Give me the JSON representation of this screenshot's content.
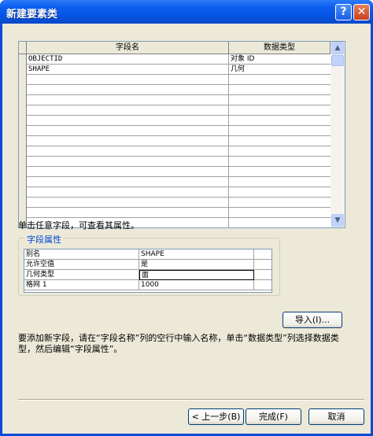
{
  "window": {
    "title": "新建要素类"
  },
  "titlebar": {
    "help_glyph": "?",
    "close_glyph": "✕"
  },
  "grid": {
    "col_field_name": "字段名",
    "col_data_type": "数据类型",
    "rows": [
      {
        "name": "OBJECTID",
        "type": "对象 ID"
      },
      {
        "name": "SHAPE",
        "type": "几何"
      }
    ]
  },
  "hint": "单击任意字段，可查看其属性。",
  "field_props": {
    "title": "字段属性",
    "rows": [
      {
        "key": "别名",
        "value": "SHAPE"
      },
      {
        "key": "允许空值",
        "value": "是"
      },
      {
        "key": "几何类型",
        "value": "面"
      },
      {
        "key": "格网 1",
        "value": "1000"
      }
    ]
  },
  "buttons": {
    "import": "导入(I)...",
    "back": "< 上一步(B)",
    "finish": "完成(F)",
    "cancel": "取消"
  },
  "description": "要添加新字段，请在“字段名称”列的空行中输入名称，单击“数据类型”列选择数据类型，然后编辑“字段属性”。"
}
